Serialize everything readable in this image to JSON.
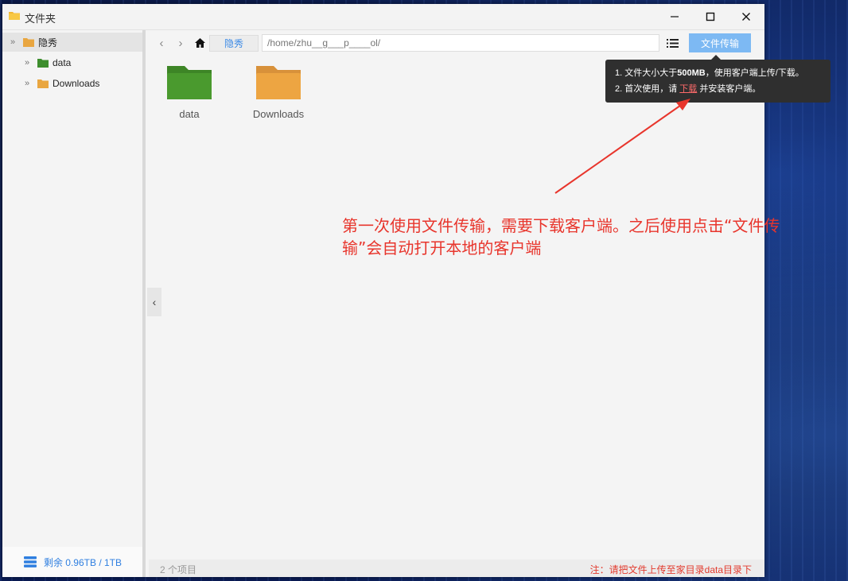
{
  "window": {
    "title": "文件夹"
  },
  "sidebar": {
    "root": {
      "label": "隐秀"
    },
    "items": [
      {
        "label": "data",
        "color": "#3e8e2e"
      },
      {
        "label": "Downloads",
        "color": "#e9a640"
      }
    ],
    "footer": {
      "storage": "剩余 0.96TB / 1TB"
    }
  },
  "toolbar": {
    "breadcrumb": "隐秀",
    "path": "/home/zhu__g___p____ol/",
    "transfer_label": "文件传输"
  },
  "tooltip": {
    "line1_pre": "1. 文件大小大于",
    "line1_bold": "500MB",
    "line1_post": "，使用客户端上传/下载。",
    "line2_pre": "2. 首次使用，请",
    "line2_link": "下载",
    "line2_post": "并安装客户端。"
  },
  "files": [
    {
      "name": "data",
      "color": "#4a9a2e",
      "tab": "#3d8526"
    },
    {
      "name": "Downloads",
      "color": "#eda542",
      "tab": "#d8913a"
    }
  ],
  "annotation": {
    "text": "第一次使用文件传输，需要下载客户端。之后使用点击“文件传输”会自动打开本地的客户端",
    "color": "#e8352c"
  },
  "statusbar": {
    "count": "2 个项目",
    "note": "注：请把文件上传至家目录data目录下"
  }
}
